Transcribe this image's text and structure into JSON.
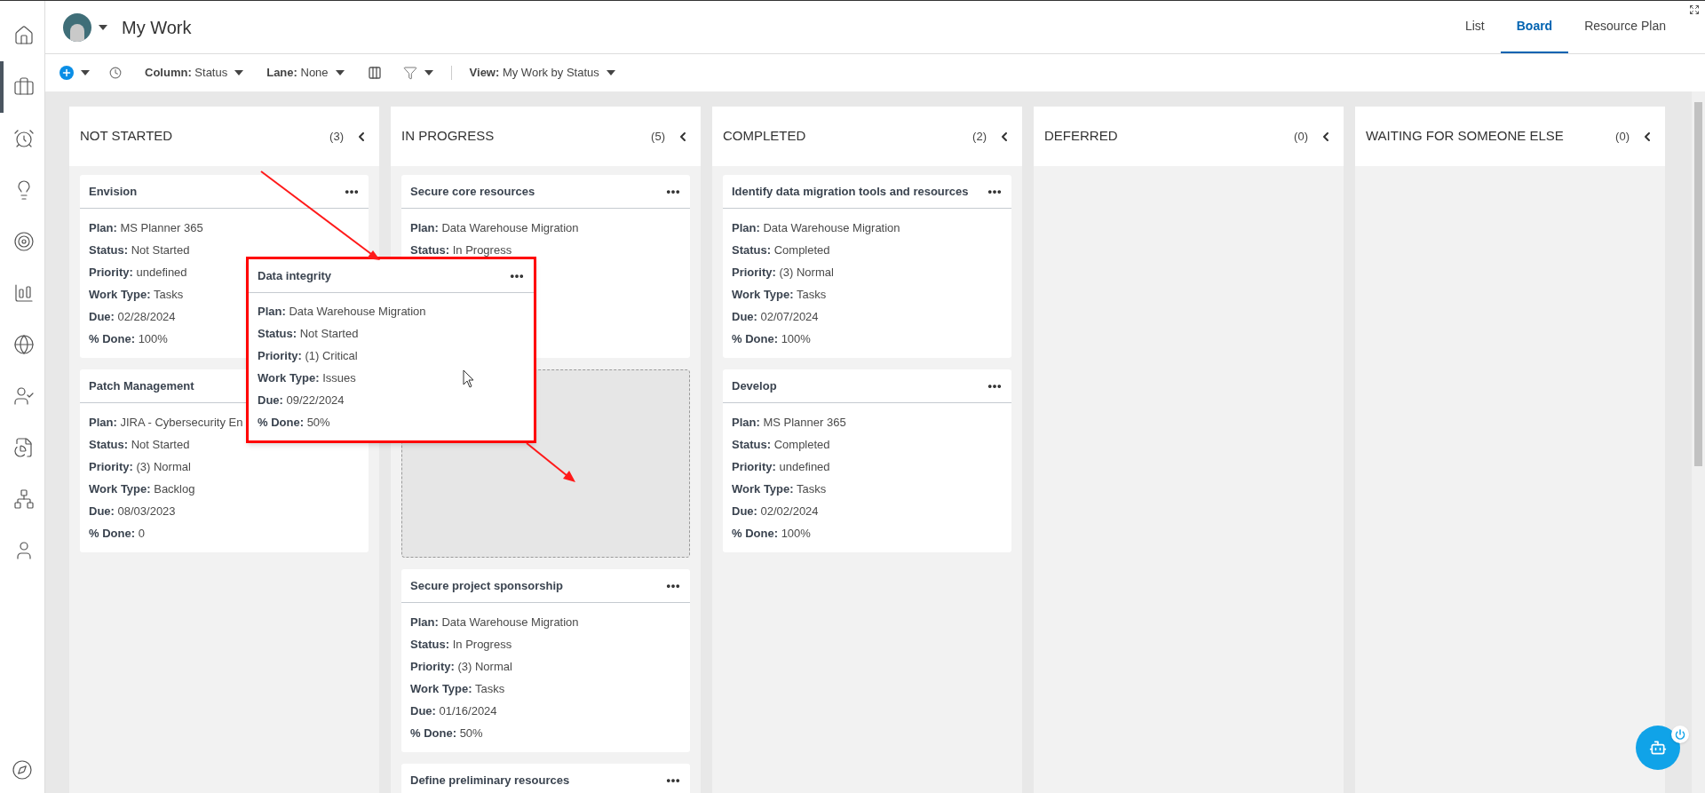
{
  "sidebar": {
    "items": [
      {
        "selected": false
      },
      {
        "selected": true
      },
      {
        "selected": false
      },
      {
        "selected": false
      },
      {
        "selected": false
      },
      {
        "selected": false
      },
      {
        "selected": false
      },
      {
        "selected": false
      },
      {
        "selected": false
      },
      {
        "selected": false
      },
      {
        "selected": false
      }
    ]
  },
  "header": {
    "title": "My Work",
    "tabs": [
      {
        "label": "List",
        "selected": false
      },
      {
        "label": "Board",
        "selected": true
      },
      {
        "label": "Resource Plan",
        "selected": false
      }
    ]
  },
  "toolbar": {
    "column": {
      "label": "Column:",
      "value": "Status"
    },
    "lane": {
      "label": "Lane:",
      "value": "None"
    },
    "view": {
      "label": "View:",
      "value": "My Work by Status"
    }
  },
  "columns": [
    {
      "title": "NOT STARTED",
      "count": "(3)",
      "cards": [
        {
          "kind": "card",
          "title": "Envision",
          "fields": [
            {
              "label": "Plan:",
              "value": "MS Planner 365"
            },
            {
              "label": "Status:",
              "value": "Not Started"
            },
            {
              "label": "Priority:",
              "value": "undefined"
            },
            {
              "label": "Work Type:",
              "value": "Tasks"
            },
            {
              "label": "Due:",
              "value": "02/28/2024"
            },
            {
              "label": "% Done:",
              "value": "100%"
            }
          ]
        },
        {
          "kind": "covered_card",
          "title": "Patch Management",
          "fields": [
            {
              "label": "Plan:",
              "value": "JIRA - Cybersecurity En"
            },
            {
              "label": "Status:",
              "value": "Not Started"
            },
            {
              "label": "Priority:",
              "value": "(3) Normal"
            },
            {
              "label": "Work Type:",
              "value": "Backlog"
            },
            {
              "label": "Due:",
              "value": "08/03/2023"
            },
            {
              "label": "% Done:",
              "value": "0"
            }
          ]
        }
      ]
    },
    {
      "title": "IN PROGRESS",
      "count": "(5)",
      "cards": [
        {
          "kind": "card",
          "title": "Secure core resources",
          "fields": [
            {
              "label": "Plan:",
              "value": "Data Warehouse Migration"
            },
            {
              "label": "Status:",
              "value": "In Progress"
            }
          ]
        },
        {
          "kind": "placeholder"
        },
        {
          "kind": "card",
          "title": "Secure project sponsorship",
          "fields": [
            {
              "label": "Plan:",
              "value": "Data Warehouse Migration"
            },
            {
              "label": "Status:",
              "value": "In Progress"
            },
            {
              "label": "Priority:",
              "value": "(3) Normal"
            },
            {
              "label": "Work Type:",
              "value": "Tasks"
            },
            {
              "label": "Due:",
              "value": "01/16/2024"
            },
            {
              "label": "% Done:",
              "value": "50%"
            }
          ]
        },
        {
          "kind": "card",
          "title": "Define preliminary resources"
        }
      ]
    },
    {
      "title": "COMPLETED",
      "count": "(2)",
      "cards": [
        {
          "kind": "card",
          "title": "Identify data migration tools and resources",
          "fields": [
            {
              "label": "Plan:",
              "value": "Data Warehouse Migration"
            },
            {
              "label": "Status:",
              "value": "Completed"
            },
            {
              "label": "Priority:",
              "value": "(3) Normal"
            },
            {
              "label": "Work Type:",
              "value": "Tasks"
            },
            {
              "label": "Due:",
              "value": "02/07/2024"
            },
            {
              "label": "% Done:",
              "value": "100%"
            }
          ]
        },
        {
          "kind": "card",
          "title": "Develop",
          "fields": [
            {
              "label": "Plan:",
              "value": "MS Planner 365"
            },
            {
              "label": "Status:",
              "value": "Completed"
            },
            {
              "label": "Priority:",
              "value": "undefined"
            },
            {
              "label": "Work Type:",
              "value": "Tasks"
            },
            {
              "label": "Due:",
              "value": "02/02/2024"
            },
            {
              "label": "% Done:",
              "value": "100%"
            }
          ]
        }
      ]
    },
    {
      "title": "DEFERRED",
      "count": "(0)"
    },
    {
      "title": "WAITING FOR SOMEONE ELSE",
      "count": "(0)"
    }
  ],
  "dragged_card": {
    "title": "Data integrity",
    "fields": [
      {
        "label": "Plan:",
        "value": "Data Warehouse Migration"
      },
      {
        "label": "Status:",
        "value": "Not Started"
      },
      {
        "label": "Priority:",
        "value": "(1) Critical"
      },
      {
        "label": "Work Type:",
        "value": "Issues"
      },
      {
        "label": "Due:",
        "value": "09/22/2024"
      },
      {
        "label": "% Done:",
        "value": "50%"
      }
    ]
  }
}
